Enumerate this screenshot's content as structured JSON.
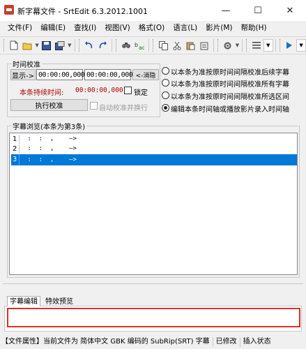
{
  "window": {
    "title": "新字幕文件 - SrtEdit 6.3.2012.1001",
    "minimize": "—",
    "maximize": "☐",
    "close": "✕"
  },
  "menu": [
    "文件(F)",
    "编辑(E)",
    "查找(I)",
    "视图(V)",
    "格式(O)",
    "语言(L)",
    "影片(M)",
    "帮助(H)"
  ],
  "toolbar": {
    "icons": [
      "new-file-icon",
      "open-folder-icon",
      "save-icon",
      "save-as-icon",
      "undo-icon",
      "redo-icon",
      "find-icon",
      "replace-icon",
      "copy-icon",
      "cut-icon",
      "paste-icon",
      "clipboard-icon",
      "list-icon",
      "play-icon"
    ]
  },
  "timing": {
    "legend": "时间校准",
    "show_button": "显示->",
    "start_time": "00:00:00,000",
    "end_time": "00:00:00,000",
    "cancel_button": "<-消隐",
    "duration_label": "本条持续时间:",
    "duration_value": "00:00:00,000",
    "lock_label": "锁定",
    "run_button": "执行校准",
    "auto_label": "自动校准并换行"
  },
  "options": [
    {
      "label": "以本条为准按原时间间隔校准后续字幕",
      "checked": false
    },
    {
      "label": "以本条为准按原时间间隔校准所有字幕",
      "checked": false
    },
    {
      "label": "以本条为准按原时间间隔校准所选区间",
      "checked": false
    },
    {
      "label": "编辑本条时间轴或播放影片录入时间轴",
      "checked": true
    }
  ],
  "browser": {
    "legend": "字幕浏览(本条为第3条)",
    "rows": [
      {
        "num": "1",
        "text": " :  :  ,    —>"
      },
      {
        "num": "2",
        "text": " :  :  ,    —>"
      },
      {
        "num": "3",
        "text": " :  :  ,    —>"
      }
    ],
    "selected_index": 2
  },
  "tabs": [
    "字幕编辑",
    "特效预览"
  ],
  "status": [
    "【文件属性】当前文件为 简体中文 GBK 编码的 SubRip(SRT) 字幕",
    "已修改",
    "插入状态"
  ]
}
